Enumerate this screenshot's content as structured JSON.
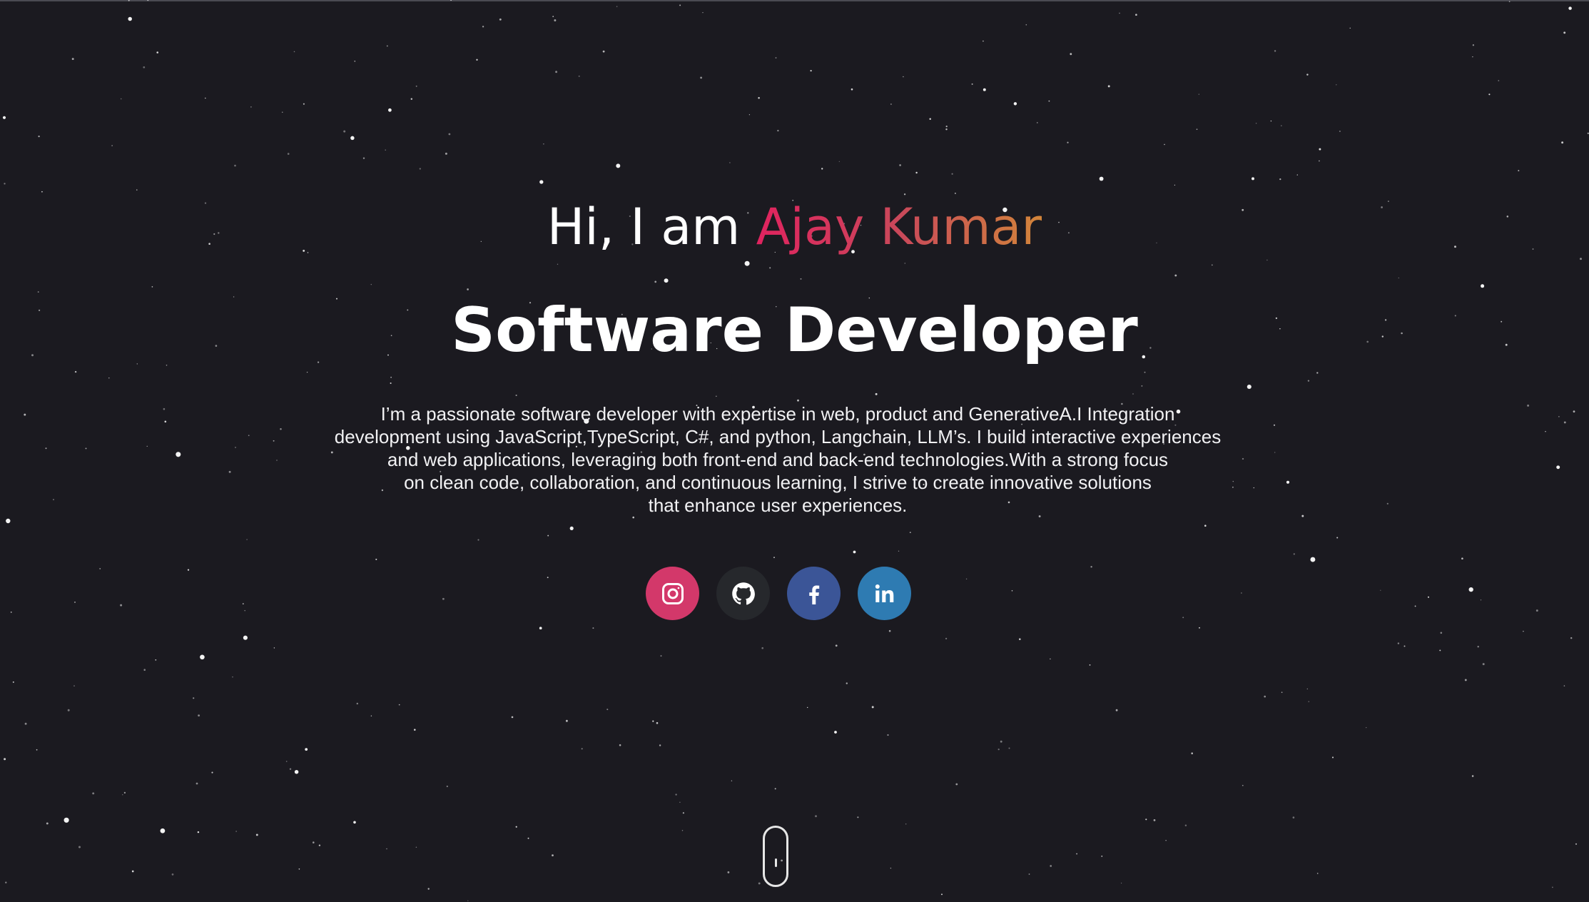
{
  "hero": {
    "greeting_prefix": "Hi, I am ",
    "name": "Ajay Kumar",
    "role": "Software Developer",
    "bio_lines": [
      "I’m a passionate software developer with expertise in web, product and GenerativeA.I Integration",
      "development using JavaScript,TypeScript, C#, and python, Langchain, LLM’s. I build interactive experiences",
      "and web applications, leveraging both front-end and back-end technologies.With a strong focus",
      "on clean code, collaboration, and continuous learning, I strive to create innovative solutions",
      "that enhance user experiences."
    ]
  },
  "socials": [
    {
      "name": "instagram",
      "icon": "instagram-icon",
      "color": "#d3386a"
    },
    {
      "name": "github",
      "icon": "github-icon",
      "color": "#26282c"
    },
    {
      "name": "facebook",
      "icon": "facebook-icon",
      "color": "#3b5597"
    },
    {
      "name": "linkedin",
      "icon": "linkedin-icon",
      "color": "#2e7bb2"
    }
  ],
  "colors": {
    "background": "#1b1a20",
    "name_gradient": [
      "#e0235f",
      "#d2853a"
    ]
  }
}
